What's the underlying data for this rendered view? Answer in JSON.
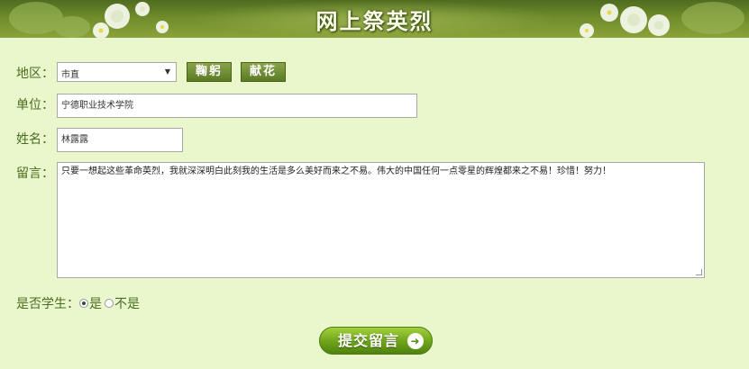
{
  "banner": {
    "title": "网上祭英烈"
  },
  "form": {
    "region": {
      "label": "地区：",
      "selected": "市直"
    },
    "actions": {
      "bow_label": "鞠躬",
      "flower_label": "献花"
    },
    "unit": {
      "label": "单位：",
      "value": "宁德职业技术学院"
    },
    "name": {
      "label": "姓名：",
      "value": "林露露"
    },
    "message": {
      "label": "留言：",
      "value": "只要一想起这些革命英烈，我就深深明白此刻我的生活是多么美好而来之不易。伟大的中国任何一点零星的辉煌都来之不易！珍惜！努力！"
    },
    "student": {
      "label": "是否学生：",
      "options": [
        {
          "label": "是",
          "checked": true
        },
        {
          "label": "不是",
          "checked": false
        }
      ]
    },
    "submit_label": "提交留言"
  },
  "colors": {
    "background": "#eaf7cd",
    "label_text": "#4a6d1f",
    "banner_dark": "#4f6b1f",
    "submit_green": "#6fa21a"
  }
}
